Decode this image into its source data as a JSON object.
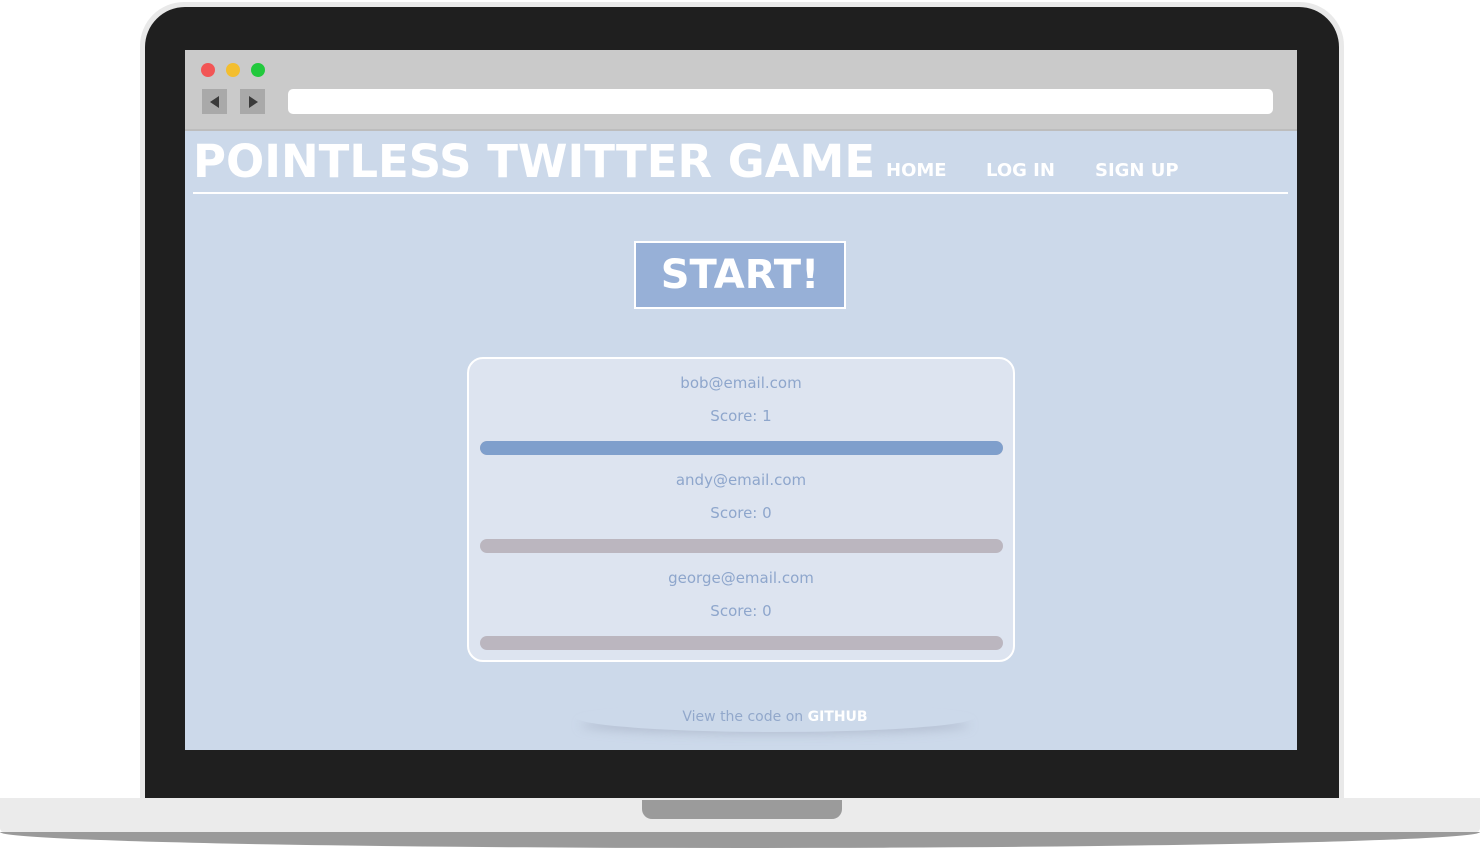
{
  "site": {
    "title": "POINTLESS TWITTER GAME"
  },
  "nav": {
    "items": [
      {
        "label": "HOME"
      },
      {
        "label": "LOG IN"
      },
      {
        "label": "SIGN UP"
      }
    ]
  },
  "browser": {
    "address": ""
  },
  "game": {
    "start_label": "START!"
  },
  "scoreboard": {
    "players": [
      {
        "email": "bob@email.com",
        "score_text": "Score: 1",
        "progress": 1.0
      },
      {
        "email": "andy@email.com",
        "score_text": "Score: 0",
        "progress": 0.0
      },
      {
        "email": "george@email.com",
        "score_text": "Score: 0",
        "progress": 0.0
      }
    ]
  },
  "footer": {
    "text": "View the code on ",
    "link_label": "GITHUB"
  },
  "colors": {
    "page_background": "#ccd9ea",
    "accent": "#97b0d7",
    "bar_fill": "#7f9fcc",
    "bar_track": "#bbb6bf",
    "card_background": "#dde4f0",
    "text_muted": "#8ea6cc"
  }
}
